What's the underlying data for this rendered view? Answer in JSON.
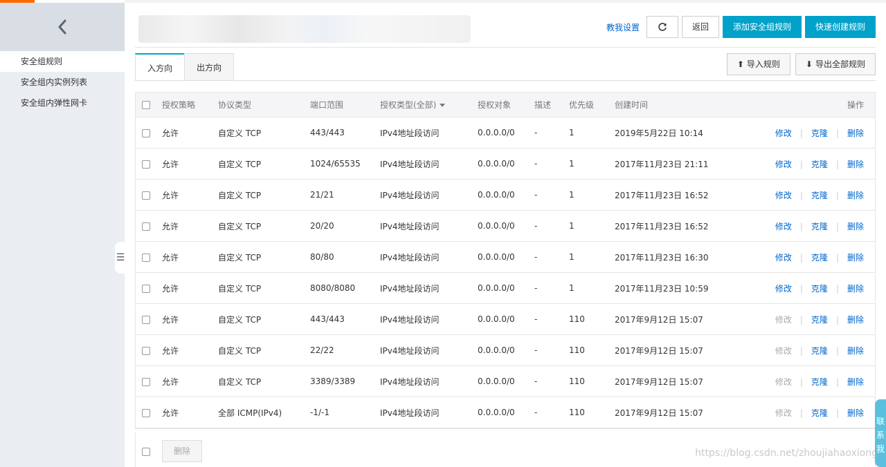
{
  "sidebar": {
    "items": [
      {
        "label": "安全组规则",
        "active": true
      },
      {
        "label": "安全组内实例列表",
        "active": false
      },
      {
        "label": "安全组内弹性网卡",
        "active": false
      }
    ]
  },
  "toolbar": {
    "tutorial_label": "教我设置",
    "refresh_icon": "refresh-icon",
    "back_label": "返回",
    "add_rule_label": "添加安全组规则",
    "quick_create_label": "快速创建规则"
  },
  "tabs": [
    {
      "label": "入方向",
      "active": true
    },
    {
      "label": "出方向",
      "active": false
    }
  ],
  "io_buttons": {
    "import_label": "导入规则",
    "export_label": "导出全部规则"
  },
  "table": {
    "headers": {
      "policy": "授权策略",
      "protocol": "协议类型",
      "port": "端口范围",
      "auth_type": "授权类型(全部)",
      "auth_object": "授权对象",
      "description": "描述",
      "priority": "优先级",
      "created": "创建时间",
      "actions": "操作"
    },
    "action_labels": {
      "edit": "修改",
      "clone": "克隆",
      "delete": "删除"
    },
    "rows": [
      {
        "policy": "允许",
        "protocol": "自定义 TCP",
        "port": "443/443",
        "auth_type": "IPv4地址段访问",
        "auth_object": "0.0.0.0/0",
        "description": "-",
        "priority": "1",
        "created": "2019年5月22日 10:14",
        "edit_enabled": true
      },
      {
        "policy": "允许",
        "protocol": "自定义 TCP",
        "port": "1024/65535",
        "auth_type": "IPv4地址段访问",
        "auth_object": "0.0.0.0/0",
        "description": "-",
        "priority": "1",
        "created": "2017年11月23日 21:11",
        "edit_enabled": true
      },
      {
        "policy": "允许",
        "protocol": "自定义 TCP",
        "port": "21/21",
        "auth_type": "IPv4地址段访问",
        "auth_object": "0.0.0.0/0",
        "description": "-",
        "priority": "1",
        "created": "2017年11月23日 16:52",
        "edit_enabled": true
      },
      {
        "policy": "允许",
        "protocol": "自定义 TCP",
        "port": "20/20",
        "auth_type": "IPv4地址段访问",
        "auth_object": "0.0.0.0/0",
        "description": "-",
        "priority": "1",
        "created": "2017年11月23日 16:52",
        "edit_enabled": true
      },
      {
        "policy": "允许",
        "protocol": "自定义 TCP",
        "port": "80/80",
        "auth_type": "IPv4地址段访问",
        "auth_object": "0.0.0.0/0",
        "description": "-",
        "priority": "1",
        "created": "2017年11月23日 16:30",
        "edit_enabled": true
      },
      {
        "policy": "允许",
        "protocol": "自定义 TCP",
        "port": "8080/8080",
        "auth_type": "IPv4地址段访问",
        "auth_object": "0.0.0.0/0",
        "description": "-",
        "priority": "1",
        "created": "2017年11月23日 10:59",
        "edit_enabled": true
      },
      {
        "policy": "允许",
        "protocol": "自定义 TCP",
        "port": "443/443",
        "auth_type": "IPv4地址段访问",
        "auth_object": "0.0.0.0/0",
        "description": "-",
        "priority": "110",
        "created": "2017年9月12日 15:07",
        "edit_enabled": false
      },
      {
        "policy": "允许",
        "protocol": "自定义 TCP",
        "port": "22/22",
        "auth_type": "IPv4地址段访问",
        "auth_object": "0.0.0.0/0",
        "description": "-",
        "priority": "110",
        "created": "2017年9月12日 15:07",
        "edit_enabled": false
      },
      {
        "policy": "允许",
        "protocol": "自定义 TCP",
        "port": "3389/3389",
        "auth_type": "IPv4地址段访问",
        "auth_object": "0.0.0.0/0",
        "description": "-",
        "priority": "110",
        "created": "2017年9月12日 15:07",
        "edit_enabled": false
      },
      {
        "policy": "允许",
        "protocol": "全部 ICMP(IPv4)",
        "port": "-1/-1",
        "auth_type": "IPv4地址段访问",
        "auth_object": "0.0.0.0/0",
        "description": "-",
        "priority": "110",
        "created": "2017年9月12日 15:07",
        "edit_enabled": false
      }
    ]
  },
  "footer": {
    "delete_label": "删除"
  },
  "watermark": "https://blog.csdn.net/zhoujiahaoxiong",
  "contact_label": "联系我",
  "colors": {
    "accent": "#00a2ca",
    "link": "#0066cc",
    "brand_orange": "#ff6a00"
  }
}
